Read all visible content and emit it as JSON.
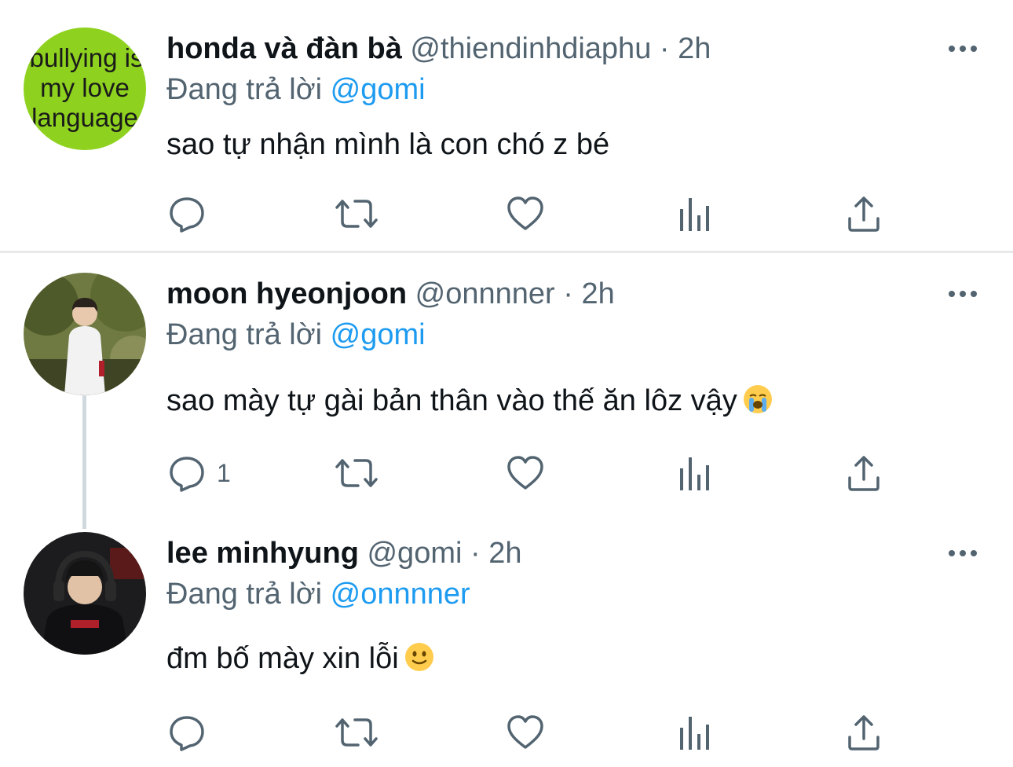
{
  "colors": {
    "name": "#0f1419",
    "secondary": "#536471",
    "mention": "#1d9bf0",
    "divider": "#e7e9ea",
    "thread_line": "#cfd9de"
  },
  "replying_prefix": "Đang trả lời",
  "tweets": [
    {
      "display_name": "honda và đàn bà",
      "handle": "@thiendinhdiaphu",
      "separator": "·",
      "time": "2h",
      "replying_to": "@gomi",
      "text": "sao tự nhận mình là con chó z bé",
      "avatar_text": [
        "bullying is",
        "my love",
        "language"
      ],
      "reply_count": ""
    },
    {
      "display_name": "moon hyeonjoon",
      "handle": "@onnnner",
      "separator": "·",
      "time": "2h",
      "replying_to": "@gomi",
      "text": "sao mày tự gài bản thân vào thế ăn lôz vậy",
      "emoji": "loudly-crying-face",
      "reply_count": "1"
    },
    {
      "display_name": "lee minhyung",
      "handle": "@gomi",
      "separator": "·",
      "time": "2h",
      "replying_to": "@onnnner",
      "text": "đm bố mày xin lỗi",
      "emoji": "slightly-smiling-face",
      "reply_count": ""
    }
  ],
  "icons": {
    "reply": "reply-icon",
    "retweet": "retweet-icon",
    "like": "heart-icon",
    "analytics": "analytics-icon",
    "share": "share-icon",
    "more": "more-icon"
  }
}
